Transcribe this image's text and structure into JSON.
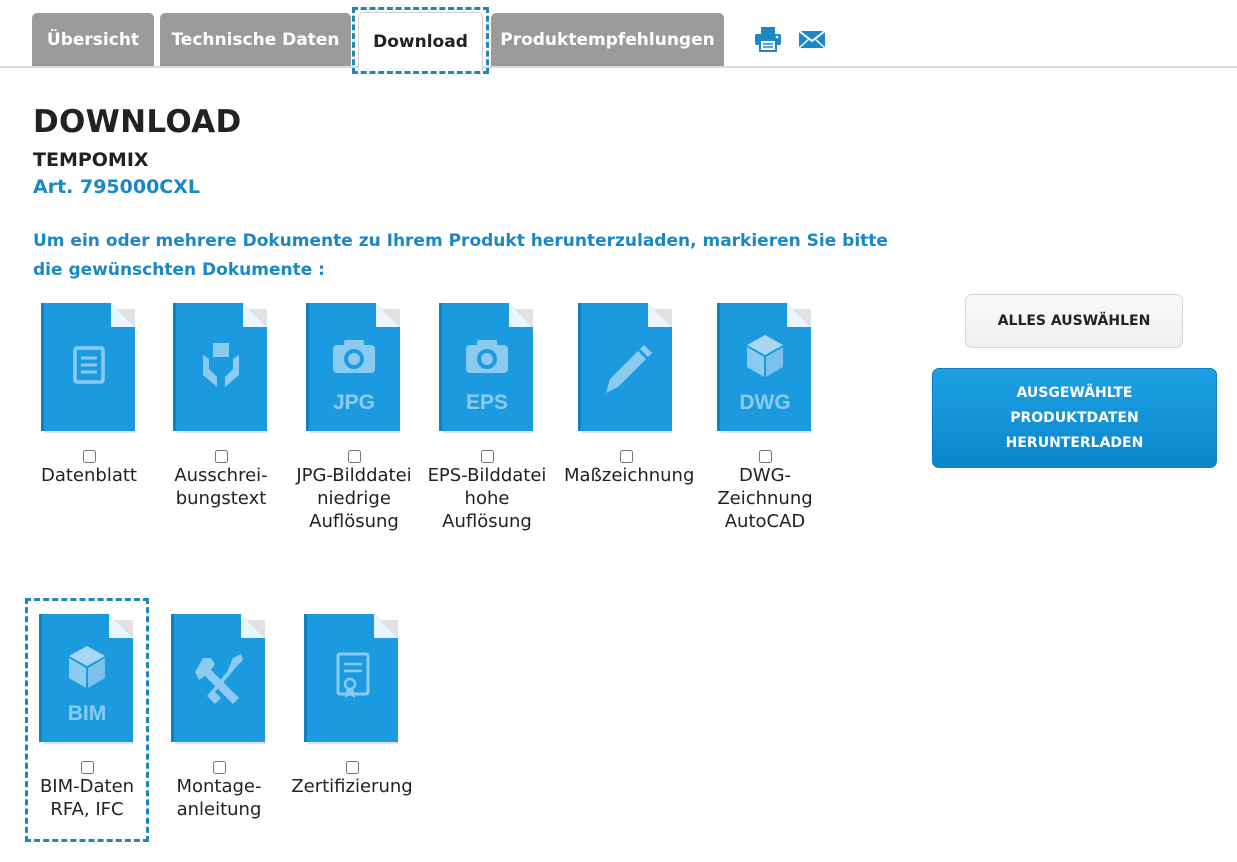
{
  "tabs": [
    {
      "label": "Übersicht"
    },
    {
      "label": "Technische Daten"
    },
    {
      "label": "Download"
    },
    {
      "label": "Produktempfehlungen"
    }
  ],
  "active_tab": "Download",
  "toolbar": {
    "print_icon": "printer-icon",
    "mail_icon": "envelope-icon"
  },
  "page": {
    "title": "DOWNLOAD",
    "product": "TEMPOMIX",
    "article": "Art. 795000CXL",
    "instruction": "Um ein oder mehrere Dokumente zu Ihrem Produkt herunterzuladen, markieren Sie bitte die gewünschten Dokumente :"
  },
  "documents": [
    {
      "label": "Datenblatt",
      "icon": "document-icon",
      "checked": false
    },
    {
      "label": "Ausschrei-\nbungstext",
      "icon": "hands-box-icon",
      "checked": false
    },
    {
      "label": "JPG-Bilddatei\nniedrige\nAuflösung",
      "icon": "camera-icon",
      "badge": "JPG",
      "checked": false
    },
    {
      "label": "EPS-Bilddatei\nhohe\nAuflösung",
      "icon": "camera-icon",
      "badge": "EPS",
      "checked": false
    },
    {
      "label": "Maßzeichnung",
      "icon": "pencil-icon",
      "checked": false
    },
    {
      "label": "DWG-Zeichnung\nAutoCAD",
      "icon": "cube-icon",
      "badge": "DWG",
      "checked": false
    },
    {
      "label": "BIM-Daten\nRFA, IFC",
      "icon": "cube-icon",
      "badge": "BIM",
      "checked": false
    },
    {
      "label": "Montage-\nanleitung",
      "icon": "tools-icon",
      "checked": false
    },
    {
      "label": "Zertifizierung",
      "icon": "certificate-icon",
      "checked": false
    }
  ],
  "actions": {
    "select_all": "ALLES AUSWÄHLEN",
    "download_selected": "AUSGEWÄHLTE\nPRODUKTDATEN\nHERUNTERLADEN"
  },
  "colors": {
    "accent": "#1a87c9",
    "file_blue": "#1b9ae0",
    "tab_grey": "#9b9b9b",
    "focus_dash": "#1f86b8"
  }
}
